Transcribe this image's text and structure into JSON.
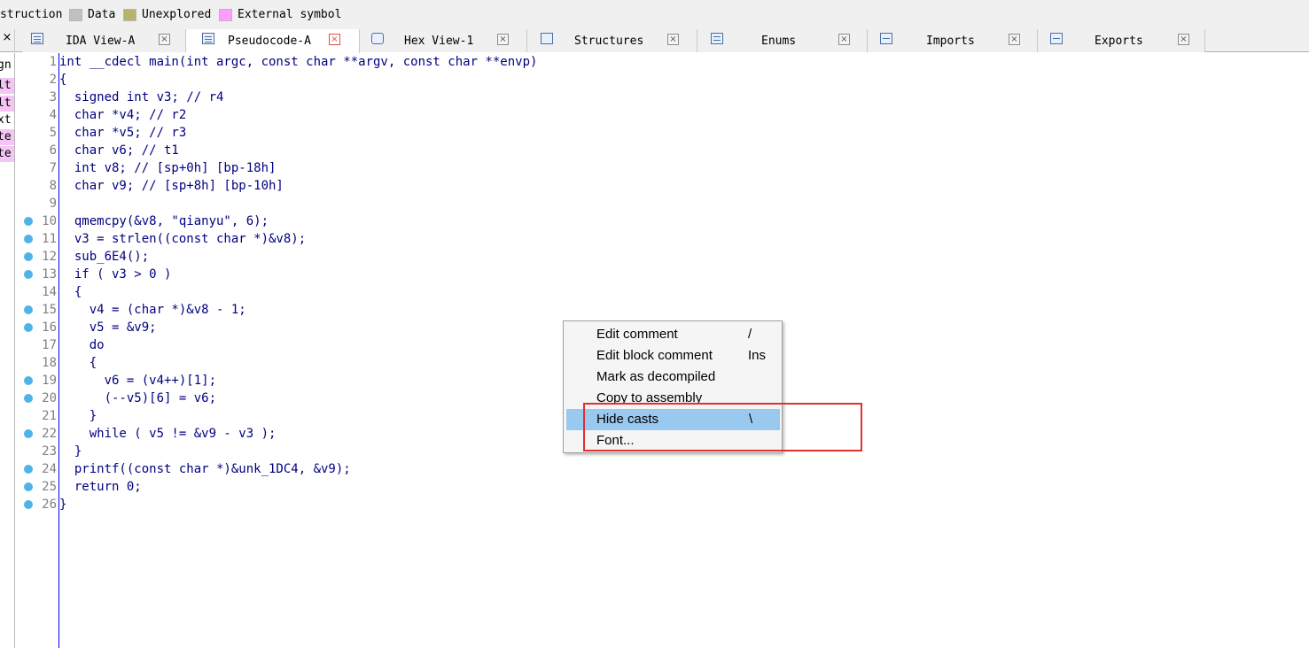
{
  "legend": {
    "items": [
      {
        "label": "struction",
        "swatch": ""
      },
      {
        "label": "Data",
        "swatch": "#c0c0c0"
      },
      {
        "label": "Unexplored",
        "swatch": "#b5b46a"
      },
      {
        "label": "External symbol",
        "swatch": "#ff9cff"
      }
    ]
  },
  "left_close": "×",
  "tabs": [
    {
      "label": "IDA View-A",
      "close": "×",
      "active": false
    },
    {
      "label": "Pseudocode-A",
      "close": "×",
      "active": true
    },
    {
      "label": "Hex View-1",
      "close": "×",
      "active": false
    },
    {
      "label": "Structures",
      "close": "×",
      "active": false
    },
    {
      "label": "Enums",
      "close": "×",
      "active": false
    },
    {
      "label": "Imports",
      "close": "×",
      "active": false
    },
    {
      "label": "Exports",
      "close": "×",
      "active": false
    }
  ],
  "nav_fragments": [
    "gn",
    "lt",
    "lt",
    "xt",
    "te",
    "te"
  ],
  "code_lines": [
    {
      "num": "1",
      "text": "int __cdecl main(int argc, const char **argv, const char **envp)",
      "bp": false
    },
    {
      "num": "2",
      "text": "{",
      "bp": false
    },
    {
      "num": "3",
      "text": "  signed int v3; // r4",
      "bp": false
    },
    {
      "num": "4",
      "text": "  char *v4; // r2",
      "bp": false
    },
    {
      "num": "5",
      "text": "  char *v5; // r3",
      "bp": false
    },
    {
      "num": "6",
      "text": "  char v6; // t1",
      "bp": false
    },
    {
      "num": "7",
      "text": "  int v8; // [sp+0h] [bp-18h]",
      "bp": false
    },
    {
      "num": "8",
      "text": "  char v9; // [sp+8h] [bp-10h]",
      "bp": false
    },
    {
      "num": "9",
      "text": "",
      "bp": false
    },
    {
      "num": "10",
      "text": "  qmemcpy(&v8, \"qianyu\", 6);",
      "bp": true
    },
    {
      "num": "11",
      "text": "  v3 = strlen((const char *)&v8);",
      "bp": true
    },
    {
      "num": "12",
      "text": "  sub_6E4();",
      "bp": true
    },
    {
      "num": "13",
      "text": "  if ( v3 > 0 )",
      "bp": true
    },
    {
      "num": "14",
      "text": "  {",
      "bp": false
    },
    {
      "num": "15",
      "text": "    v4 = (char *)&v8 - 1;",
      "bp": true
    },
    {
      "num": "16",
      "text": "    v5 = &v9;",
      "bp": true
    },
    {
      "num": "17",
      "text": "    do",
      "bp": false
    },
    {
      "num": "18",
      "text": "    {",
      "bp": false
    },
    {
      "num": "19",
      "text": "      v6 = (v4++)[1];",
      "bp": true
    },
    {
      "num": "20",
      "text": "      (--v5)[6] = v6;",
      "bp": true
    },
    {
      "num": "21",
      "text": "    }",
      "bp": false
    },
    {
      "num": "22",
      "text": "    while ( v5 != &v9 - v3 );",
      "bp": true
    },
    {
      "num": "23",
      "text": "  }",
      "bp": false
    },
    {
      "num": "24",
      "text": "  printf((const char *)&unk_1DC4, &v9);",
      "bp": true
    },
    {
      "num": "25",
      "text": "  return 0;",
      "bp": true
    },
    {
      "num": "26",
      "text": "}",
      "bp": true
    }
  ],
  "context_menu": {
    "items": [
      {
        "label": "Edit comment",
        "shortcut": "/",
        "highlighted": false
      },
      {
        "label": "Edit block comment",
        "shortcut": "Ins",
        "highlighted": false
      },
      {
        "label": "Mark as decompiled",
        "shortcut": "",
        "highlighted": false
      },
      {
        "label": "Copy to assembly",
        "shortcut": "",
        "highlighted": false
      },
      {
        "label": "Hide casts",
        "shortcut": "\\",
        "highlighted": true
      },
      {
        "label": "Font...",
        "shortcut": "",
        "highlighted": false
      }
    ]
  },
  "colors": {
    "code_text": "#000080",
    "line_number": "#808080",
    "breakpoint": "#4fb3e8",
    "menu_highlight": "#99c9ef",
    "annotation_box": "#e03030"
  }
}
